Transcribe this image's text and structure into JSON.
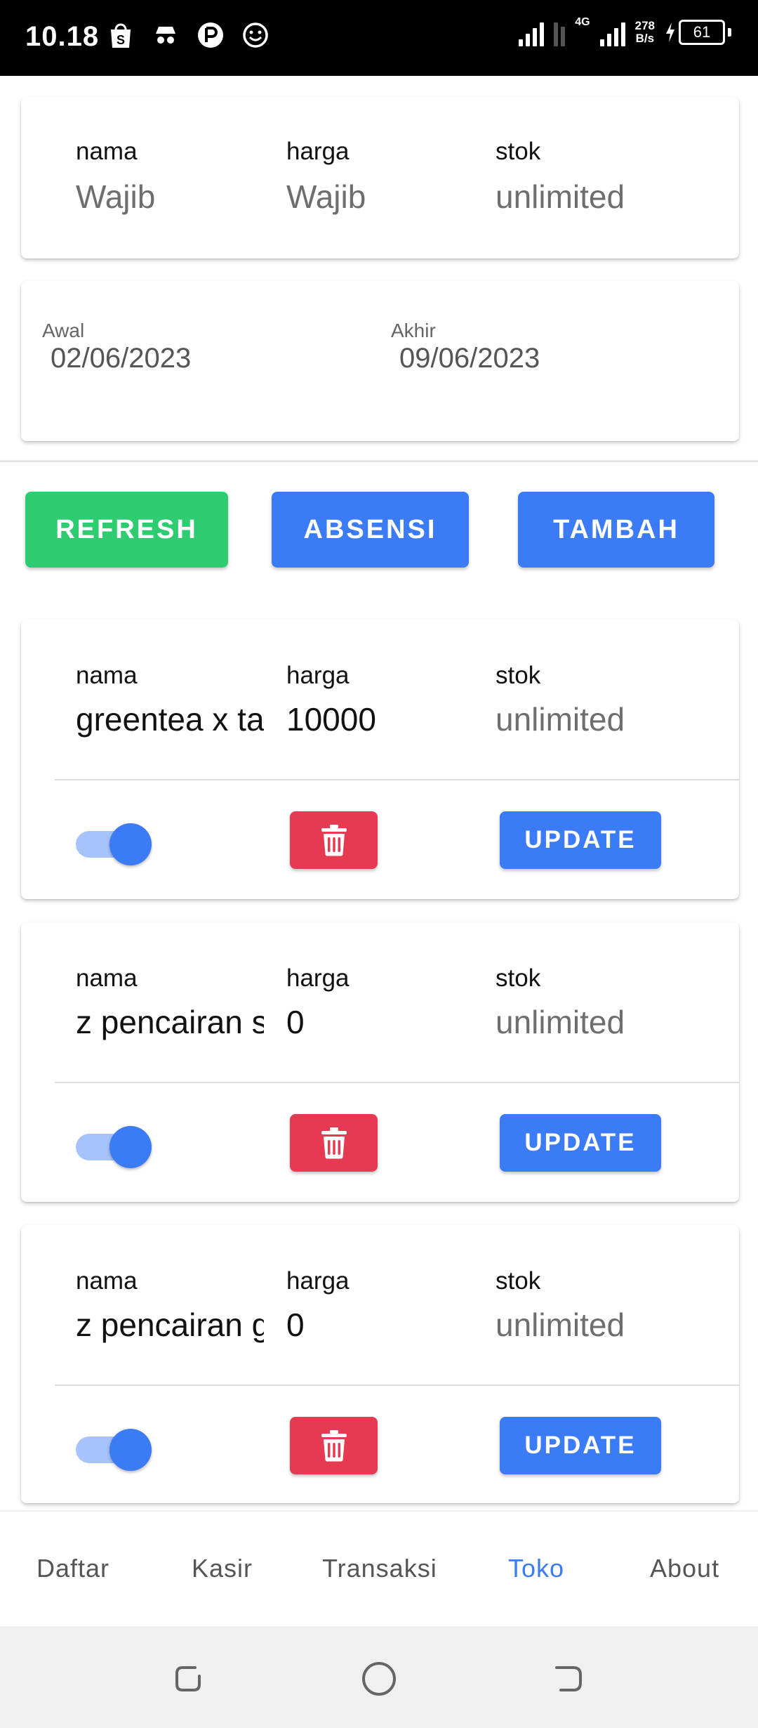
{
  "status_bar": {
    "time": "10.18",
    "network_type": "4G",
    "net_speed_value": "278",
    "net_speed_unit": "B/s",
    "battery": "61",
    "icons": [
      "shopee-icon",
      "incognito-icon",
      "app-icon",
      "smiley-icon"
    ]
  },
  "header_card": {
    "columns": [
      {
        "label": "nama",
        "value": "Wajib"
      },
      {
        "label": "harga",
        "value": "Wajib"
      },
      {
        "label": "stok",
        "value": "unlimited"
      }
    ]
  },
  "date_card": {
    "start_label": "Awal",
    "start_value": "02/06/2023",
    "end_label": "Akhir",
    "end_value": "09/06/2023"
  },
  "actions": {
    "refresh": "REFRESH",
    "absensi": "ABSENSI",
    "tambah": "TAMBAH",
    "colors": {
      "green": "#2ecc71",
      "blue": "#3b7bf6",
      "red": "#e63a52"
    }
  },
  "products": [
    {
      "labels": {
        "nama": "nama",
        "harga": "harga",
        "stok": "stok"
      },
      "nama": "greentea x ta",
      "harga": "10000",
      "stok": "unlimited",
      "active": true,
      "update_label": "UPDATE"
    },
    {
      "labels": {
        "nama": "nama",
        "harga": "harga",
        "stok": "stok"
      },
      "nama": "z pencairan s",
      "harga": "0",
      "stok": "unlimited",
      "active": true,
      "update_label": "UPDATE"
    },
    {
      "labels": {
        "nama": "nama",
        "harga": "harga",
        "stok": "stok"
      },
      "nama": "z pencairan g",
      "harga": "0",
      "stok": "unlimited",
      "active": true,
      "update_label": "UPDATE"
    }
  ],
  "bottom_nav": {
    "items": [
      "Daftar",
      "Kasir",
      "Transaksi",
      "Toko",
      "About"
    ],
    "active": "Toko"
  }
}
